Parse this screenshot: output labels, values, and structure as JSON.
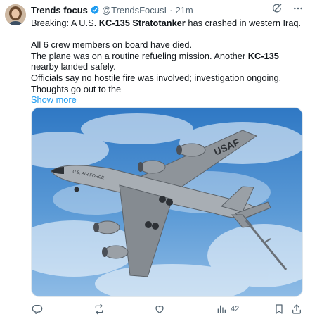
{
  "author": {
    "name": "Trends focus",
    "handle": "@TrendsFocusI",
    "separator": "·",
    "time": "21m"
  },
  "post": {
    "line1_pre": "Breaking: A U.S. ",
    "line1_bold": "KC-135 Stratotanker",
    "line1_post": " has crashed in western Iraq.",
    "line2": "All 6 crew members on board have died.",
    "line3_pre": "The plane was on a routine refueling mission. Another ",
    "line3_bold": "KC-135",
    "line3_post": " nearby landed safely.",
    "line4": "Officials say no hostile fire was involved; investigation ongoing.",
    "line5": "Thoughts go out to the",
    "show_more": "Show more"
  },
  "image": {
    "fuselage_text": "U.S. AIR FORCE",
    "wing_text": "USAF"
  },
  "actions": {
    "views": "42"
  },
  "icons": {
    "verified": "verified-badge-icon",
    "grok": "grok-icon",
    "more": "more-icon",
    "reply": "reply-icon",
    "repost": "repost-icon",
    "like": "like-icon",
    "views": "views-icon",
    "bookmark": "bookmark-icon",
    "share": "share-icon"
  },
  "colors": {
    "accent": "#1d9bf0",
    "text": "#0f1419",
    "secondary": "#536471"
  }
}
